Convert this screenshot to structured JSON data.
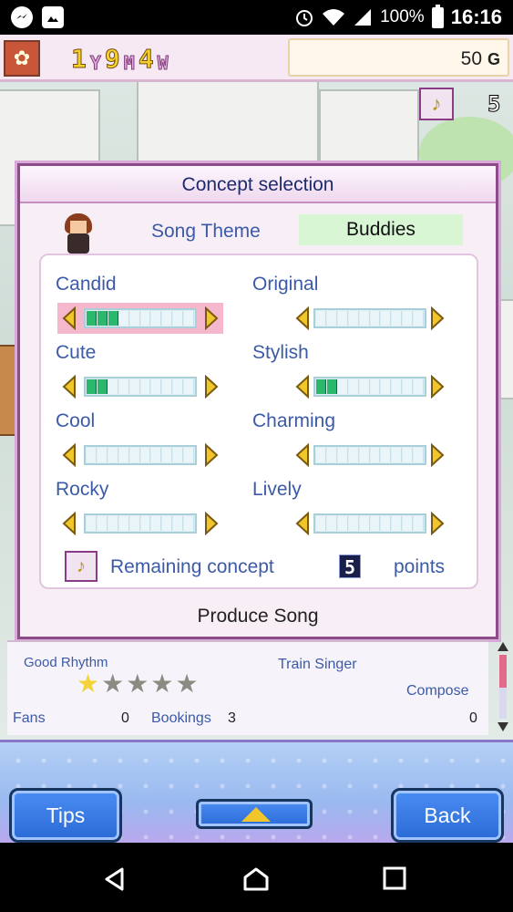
{
  "status_bar": {
    "battery": "100%",
    "time": "16:16"
  },
  "hud": {
    "date": {
      "year": "1",
      "year_unit": "Y",
      "month": "9",
      "month_unit": "M",
      "week": "4",
      "week_unit": "W"
    },
    "money": "50",
    "money_unit": "G",
    "record_count": "5"
  },
  "dialog": {
    "title": "Concept selection",
    "theme_label": "Song Theme",
    "theme_value": "Buddies",
    "concepts": [
      {
        "label": "Candid",
        "level": 3,
        "max": 10,
        "highlighted": true
      },
      {
        "label": "Original",
        "level": 0,
        "max": 10,
        "highlighted": false
      },
      {
        "label": "Cute",
        "level": 2,
        "max": 10,
        "highlighted": false
      },
      {
        "label": "Stylish",
        "level": 2,
        "max": 10,
        "highlighted": false
      },
      {
        "label": "Cool",
        "level": 0,
        "max": 10,
        "highlighted": false
      },
      {
        "label": "Charming",
        "level": 0,
        "max": 10,
        "highlighted": false
      },
      {
        "label": "Rocky",
        "level": 0,
        "max": 10,
        "highlighted": false
      },
      {
        "label": "Lively",
        "level": 0,
        "max": 10,
        "highlighted": false
      }
    ],
    "remaining_label": "Remaining concept",
    "remaining_value": "5",
    "remaining_unit": "points",
    "produce_label": "Produce Song"
  },
  "info": {
    "rhythm_label": "Good Rhythm",
    "rhythm_stars": 1,
    "rhythm_stars_max": 5,
    "singer_label": "Train Singer",
    "compose_label": "Compose",
    "compose_value": "0",
    "fans_label": "Fans",
    "fans_value": "0",
    "bookings_label": "Bookings",
    "bookings_value": "3"
  },
  "buttons": {
    "tips": "Tips",
    "back": "Back"
  },
  "colors": {
    "label_blue": "#3b5aa8",
    "slider_fill": "#2bb86e",
    "highlight_pink": "#f4b7cc",
    "theme_green": "#d8f5d4"
  }
}
